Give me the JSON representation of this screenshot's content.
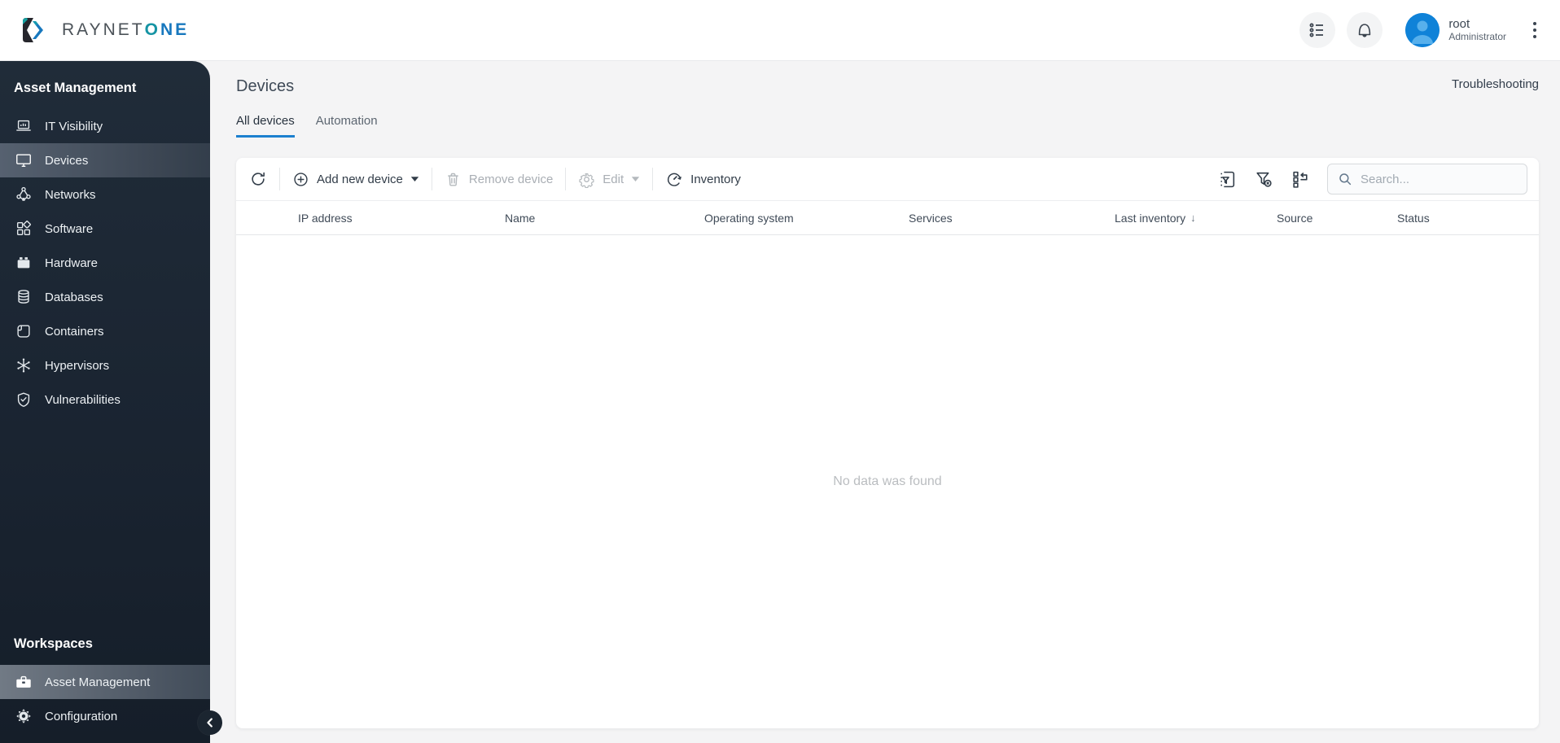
{
  "brand": {
    "text_main": "RAYNET",
    "text_o": "O",
    "text_ne": "NE"
  },
  "topbar": {
    "user_name": "root",
    "user_role": "Administrator"
  },
  "sidebar": {
    "section_title": "Asset Management",
    "items": [
      {
        "label": "IT Visibility",
        "active": false
      },
      {
        "label": "Devices",
        "active": true
      },
      {
        "label": "Networks",
        "active": false
      },
      {
        "label": "Software",
        "active": false
      },
      {
        "label": "Hardware",
        "active": false
      },
      {
        "label": "Databases",
        "active": false
      },
      {
        "label": "Containers",
        "active": false
      },
      {
        "label": "Hypervisors",
        "active": false
      },
      {
        "label": "Vulnerabilities",
        "active": false
      }
    ],
    "workspaces_title": "Workspaces",
    "workspaces": [
      {
        "label": "Asset Management",
        "active": true
      },
      {
        "label": "Configuration",
        "active": false
      }
    ]
  },
  "page": {
    "title": "Devices",
    "link": "Troubleshooting",
    "tabs": [
      {
        "label": "All devices",
        "active": true
      },
      {
        "label": "Automation",
        "active": false
      }
    ]
  },
  "toolbar": {
    "add_label": "Add new device",
    "remove_label": "Remove device",
    "edit_label": "Edit",
    "inventory_label": "Inventory",
    "search_placeholder": "Search..."
  },
  "table": {
    "columns": [
      "IP address",
      "Name",
      "Operating system",
      "Services",
      "Last inventory",
      "Source",
      "Status"
    ],
    "sort_column": "Last inventory",
    "sort_direction": "desc",
    "sort_icon": "↓",
    "empty_message": "No data was found"
  },
  "colors": {
    "accent_blue": "#1c80cf",
    "brand_teal": "#1694a4",
    "brand_blue": "#1878be",
    "sidebar_bg": "#1d2834",
    "avatar_blue": "#0f82d8",
    "page_bg": "#f4f4f5"
  }
}
